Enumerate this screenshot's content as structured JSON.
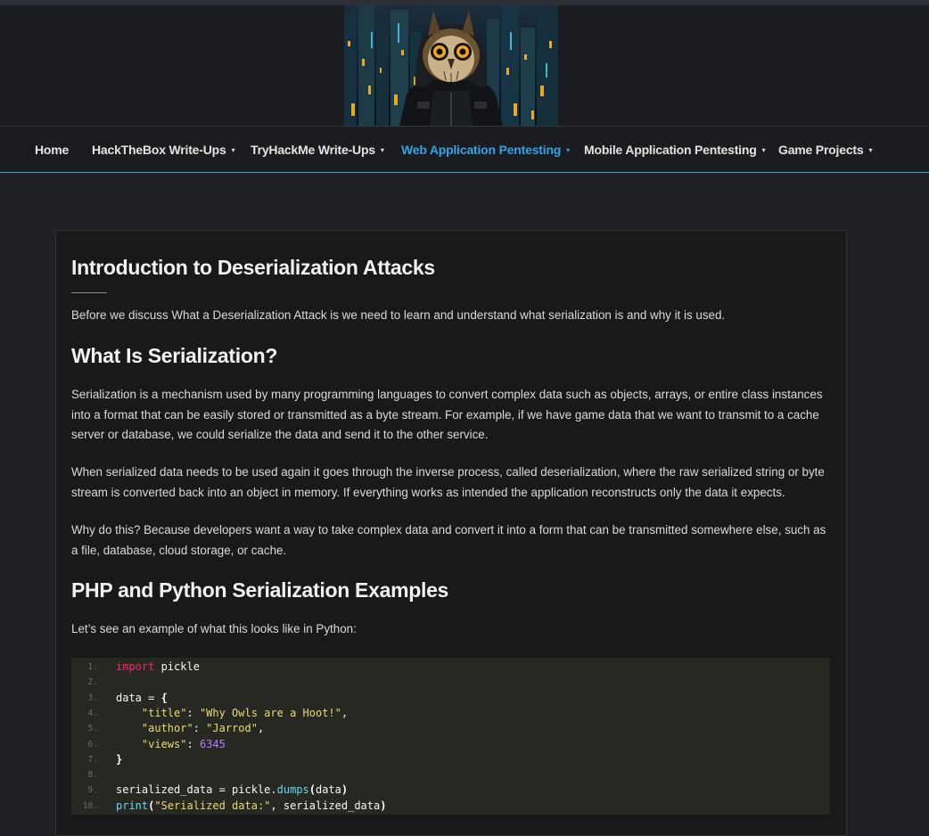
{
  "nav": {
    "items": [
      {
        "label": "Home",
        "dropdown": false,
        "active": false
      },
      {
        "label": "HackTheBox Write-Ups",
        "dropdown": true,
        "active": false
      },
      {
        "label": "TryHackMe Write-Ups",
        "dropdown": true,
        "active": false
      },
      {
        "label": "Web Application Pentesting",
        "dropdown": true,
        "active": true
      },
      {
        "label": "Mobile Application Pentesting",
        "dropdown": true,
        "active": false
      },
      {
        "label": "Game Projects",
        "dropdown": true,
        "active": false
      }
    ],
    "caret_icon": "▾"
  },
  "colors": {
    "accent": "#2fa4e7",
    "background": "#1f2023",
    "card": "#18191b",
    "code_bg": "#272822"
  },
  "article": {
    "title": "Introduction to Deserialization Attacks",
    "intro": "Before we discuss What a Deserialization Attack is we need to learn and understand what serialization is and why it is used.",
    "section1_heading": "What Is Serialization?",
    "section1_p1": "Serialization is a mechanism used by many programming languages to convert complex data such as objects, arrays, or entire class instances into a format that can be easily stored or transmitted as a byte stream. For example, if we have game data that we want to transmit to a cache server or database, we could serialize the data and send it to the other service.",
    "section1_p2": "When serialized data needs to be used again it goes through the inverse process, called deserialization, where the raw serialized string or byte stream is converted back into an object in memory. If everything works as intended the application reconstructs only the data it expects.",
    "section1_p3": "Why do this? Because developers want a way to take complex data and convert it into a form that can be transmitted somewhere else, such as a file, database, cloud storage, or cache.",
    "section2_heading": "PHP and Python Serialization Examples",
    "section2_p1": "Let’s see an example of what this looks like in Python:"
  },
  "code": {
    "lines": [
      {
        "n": "1.",
        "tokens": [
          {
            "t": "import",
            "c": "kw"
          },
          {
            "t": " pickle",
            "c": ""
          }
        ]
      },
      {
        "n": "2.",
        "tokens": []
      },
      {
        "n": "3.",
        "tokens": [
          {
            "t": "data = ",
            "c": ""
          },
          {
            "t": "{",
            "c": "br"
          }
        ]
      },
      {
        "n": "4.",
        "tokens": [
          {
            "t": "    ",
            "c": ""
          },
          {
            "t": "\"title\"",
            "c": "str"
          },
          {
            "t": ": ",
            "c": ""
          },
          {
            "t": "\"Why Owls are a Hoot!\"",
            "c": "str"
          },
          {
            "t": ",",
            "c": ""
          }
        ]
      },
      {
        "n": "5.",
        "tokens": [
          {
            "t": "    ",
            "c": ""
          },
          {
            "t": "\"author\"",
            "c": "str"
          },
          {
            "t": ": ",
            "c": ""
          },
          {
            "t": "\"Jarrod\"",
            "c": "str"
          },
          {
            "t": ",",
            "c": ""
          }
        ]
      },
      {
        "n": "6.",
        "tokens": [
          {
            "t": "    ",
            "c": ""
          },
          {
            "t": "\"views\"",
            "c": "str"
          },
          {
            "t": ": ",
            "c": ""
          },
          {
            "t": "6345",
            "c": "num"
          }
        ]
      },
      {
        "n": "7.",
        "tokens": [
          {
            "t": "}",
            "c": "br"
          }
        ]
      },
      {
        "n": "8.",
        "tokens": []
      },
      {
        "n": "9.",
        "tokens": [
          {
            "t": "serialized_data = pickle.",
            "c": ""
          },
          {
            "t": "dumps",
            "c": "fn"
          },
          {
            "t": "(",
            "c": "br"
          },
          {
            "t": "data",
            "c": ""
          },
          {
            "t": ")",
            "c": "br"
          }
        ]
      },
      {
        "n": "10.",
        "tokens": [
          {
            "t": "print",
            "c": "fn"
          },
          {
            "t": "(",
            "c": "br"
          },
          {
            "t": "\"Serialized data:\"",
            "c": "str"
          },
          {
            "t": ", serialized_data",
            "c": ""
          },
          {
            "t": ")",
            "c": "br"
          }
        ]
      }
    ]
  }
}
